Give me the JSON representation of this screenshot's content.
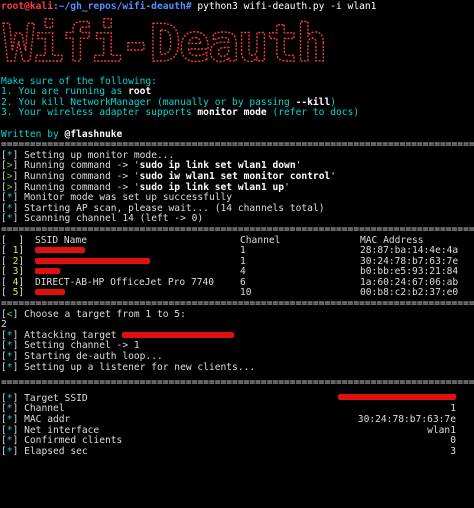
{
  "prompt": {
    "user_host": "root@kali",
    "path": ":~/gh_repos/wifi-deauth#",
    "command": " python3 wifi-deauth.py -i wlan1"
  },
  "banner_text": "Wifi-Deauth",
  "instructions": {
    "heading": "Make sure of the following:",
    "item1_pre": "1. You are running as ",
    "item1_bold": "root",
    "item2_pre": "2. You kill NetworkManager (manually or by passing ",
    "item2_bold": "--kill",
    "item2_post": ")",
    "item3_pre": "3. Your wireless adapter supports ",
    "item3_bold": "monitor mode",
    "item3_post": " (refer to docs)"
  },
  "author": {
    "pre": "Written by ",
    "bold": "@flashnuke"
  },
  "separator": "================================================================================================",
  "setup_log": [
    {
      "mark": "*",
      "color": "cyan",
      "text": "Setting up monitor mode..."
    },
    {
      "mark": ">",
      "color": "green",
      "text_pre": "Running command -> '",
      "cmd": "sudo ip link set wlan1 down",
      "text_post": "'"
    },
    {
      "mark": ">",
      "color": "green",
      "text_pre": "Running command -> '",
      "cmd": "sudo iw wlan1 set monitor control",
      "text_post": "'"
    },
    {
      "mark": ">",
      "color": "green",
      "text_pre": "Running command -> '",
      "cmd": "sudo ip link set wlan1 up",
      "text_post": "'"
    },
    {
      "mark": "*",
      "color": "cyan",
      "text": "Monitor mode was set up successfully"
    },
    {
      "mark": "*",
      "color": "cyan",
      "text": "Starting AP scan, please wait... (14 channels total)"
    },
    {
      "mark": "*",
      "color": "cyan",
      "text": "Scanning channel 14 (left -> 0)"
    }
  ],
  "scan_table": {
    "headers": {
      "index": "[  ]",
      "ssid": "SSID Name",
      "channel": "Channel",
      "mac": "MAC Address"
    },
    "rows": [
      {
        "index": "1",
        "ssid": "",
        "channel": "1",
        "mac": "28:87:ba:14:4e:4a"
      },
      {
        "index": "2",
        "ssid": "",
        "channel": "1",
        "mac": "30:24:78:b7:63:7e"
      },
      {
        "index": "3",
        "ssid": "",
        "channel": "4",
        "mac": "b0:bb:e5:93:21:84"
      },
      {
        "index": "4",
        "ssid": "DIRECT-AB-HP OfficeJet Pro 7740",
        "channel": "6",
        "mac": "1a:60:24:67:06:ab"
      },
      {
        "index": "5",
        "ssid": "",
        "channel": "10",
        "mac": "00:b8:c2:b2:37:e0"
      }
    ]
  },
  "choose": {
    "mark": "<",
    "text": "Choose a target from 1 to 5:",
    "answer": "2"
  },
  "attack_log": [
    {
      "mark": "*",
      "text": "Attacking target "
    },
    {
      "mark": "*",
      "text": "Setting channel -> 1"
    },
    {
      "mark": "*",
      "text": "Starting de-auth loop..."
    },
    {
      "mark": "*",
      "text": "Setting up a listener for new clients..."
    }
  ],
  "status": {
    "target_ssid": {
      "label": "Target SSID",
      "value": ""
    },
    "channel": {
      "label": "Channel",
      "value": "1"
    },
    "mac_addr": {
      "label": "MAC addr",
      "value": "30:24:78:b7:63:7e"
    },
    "net_interface": {
      "label": "Net interface",
      "value": "wlan1"
    },
    "confirmed_clients": {
      "label": "Confirmed clients",
      "value": "0"
    },
    "elapsed_sec": {
      "label": "Elapsed sec",
      "value": "3"
    }
  },
  "colors": {
    "red": "#ff3b3b",
    "green": "#3ee03e",
    "cyan": "#00d7d7",
    "blue": "#5b8cff",
    "yellow": "#e8e832",
    "redaction": "#e01010"
  }
}
